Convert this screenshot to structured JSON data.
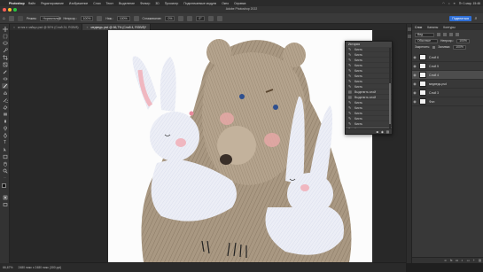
{
  "menubar": {
    "app": "Photoshop",
    "items": [
      "Файл",
      "Редактирование",
      "Изображение",
      "Слои",
      "Текст",
      "Выделение",
      "Фильтр",
      "3D",
      "Просмотр",
      "Подключаемые модули",
      "Окно",
      "Справка"
    ],
    "right_status": "Пт 1 мар. 15:46"
  },
  "window": {
    "title": "Adobe Photoshop 2022"
  },
  "options": {
    "mode_label": "Режим:",
    "mode_value": "Нормальный",
    "opacity_label": "Непрозр.:",
    "opacity_value": "100%",
    "flow_label": "Наж.:",
    "flow_value": "100%",
    "smoothing_label": "Сглаживание:",
    "smoothing_value": "0%",
    "angle_value": "0°",
    "share_label": "Поделиться"
  },
  "tabs": [
    {
      "label": "котик и зайцы.psd @ 50% (Слой 24, RGB/8)",
      "active": false
    },
    {
      "label": "медведь.psd @ 66,7% (Слой 4, RGB/8)*",
      "active": true
    }
  ],
  "status": {
    "zoom": "66,67%",
    "doc_info": "2480 пикс x 2480 пикс (300 ppi)"
  },
  "history": {
    "title": "История",
    "items": [
      {
        "label": "Кисть",
        "icon": "brush-icon"
      },
      {
        "label": "Кисть",
        "icon": "brush-icon"
      },
      {
        "label": "Кисть",
        "icon": "brush-icon"
      },
      {
        "label": "Кисть",
        "icon": "brush-icon"
      },
      {
        "label": "Кисть",
        "icon": "brush-icon"
      },
      {
        "label": "Кисть",
        "icon": "brush-icon"
      },
      {
        "label": "Кисть",
        "icon": "brush-icon"
      },
      {
        "label": "Кисть",
        "icon": "brush-icon"
      },
      {
        "label": "Выделить слой",
        "icon": "layer-icon"
      },
      {
        "label": "Выделить слой",
        "icon": "layer-icon"
      },
      {
        "label": "Кисть",
        "icon": "brush-icon"
      },
      {
        "label": "Кисть",
        "icon": "brush-icon"
      },
      {
        "label": "Кисть",
        "icon": "brush-icon"
      },
      {
        "label": "Кисть",
        "icon": "brush-icon"
      },
      {
        "label": "Кисть",
        "icon": "brush-icon"
      },
      {
        "label": "Кисть",
        "icon": "brush-icon"
      }
    ]
  },
  "layers_panel": {
    "tabs": [
      "Слои",
      "Каналы",
      "Контуры"
    ],
    "kind_label": "Вид",
    "blend_mode": "Обычные",
    "opacity_label": "Непрозр.:",
    "opacity_value": "100%",
    "fill_label": "Заливка:",
    "fill_value": "100%",
    "lock_label": "Закрепить:",
    "layers": [
      {
        "name": "Слой 6",
        "selected": false
      },
      {
        "name": "Слой 5",
        "selected": false
      },
      {
        "name": "Слой 4",
        "selected": true
      },
      {
        "name": "медведь.psd",
        "selected": false
      },
      {
        "name": "Слой 3",
        "selected": false
      },
      {
        "name": "Фон",
        "selected": false
      }
    ]
  },
  "colors": {
    "accent": "#2f6fd6",
    "panel_bg": "#383838",
    "canvas_bg": "#fcfcfc"
  }
}
